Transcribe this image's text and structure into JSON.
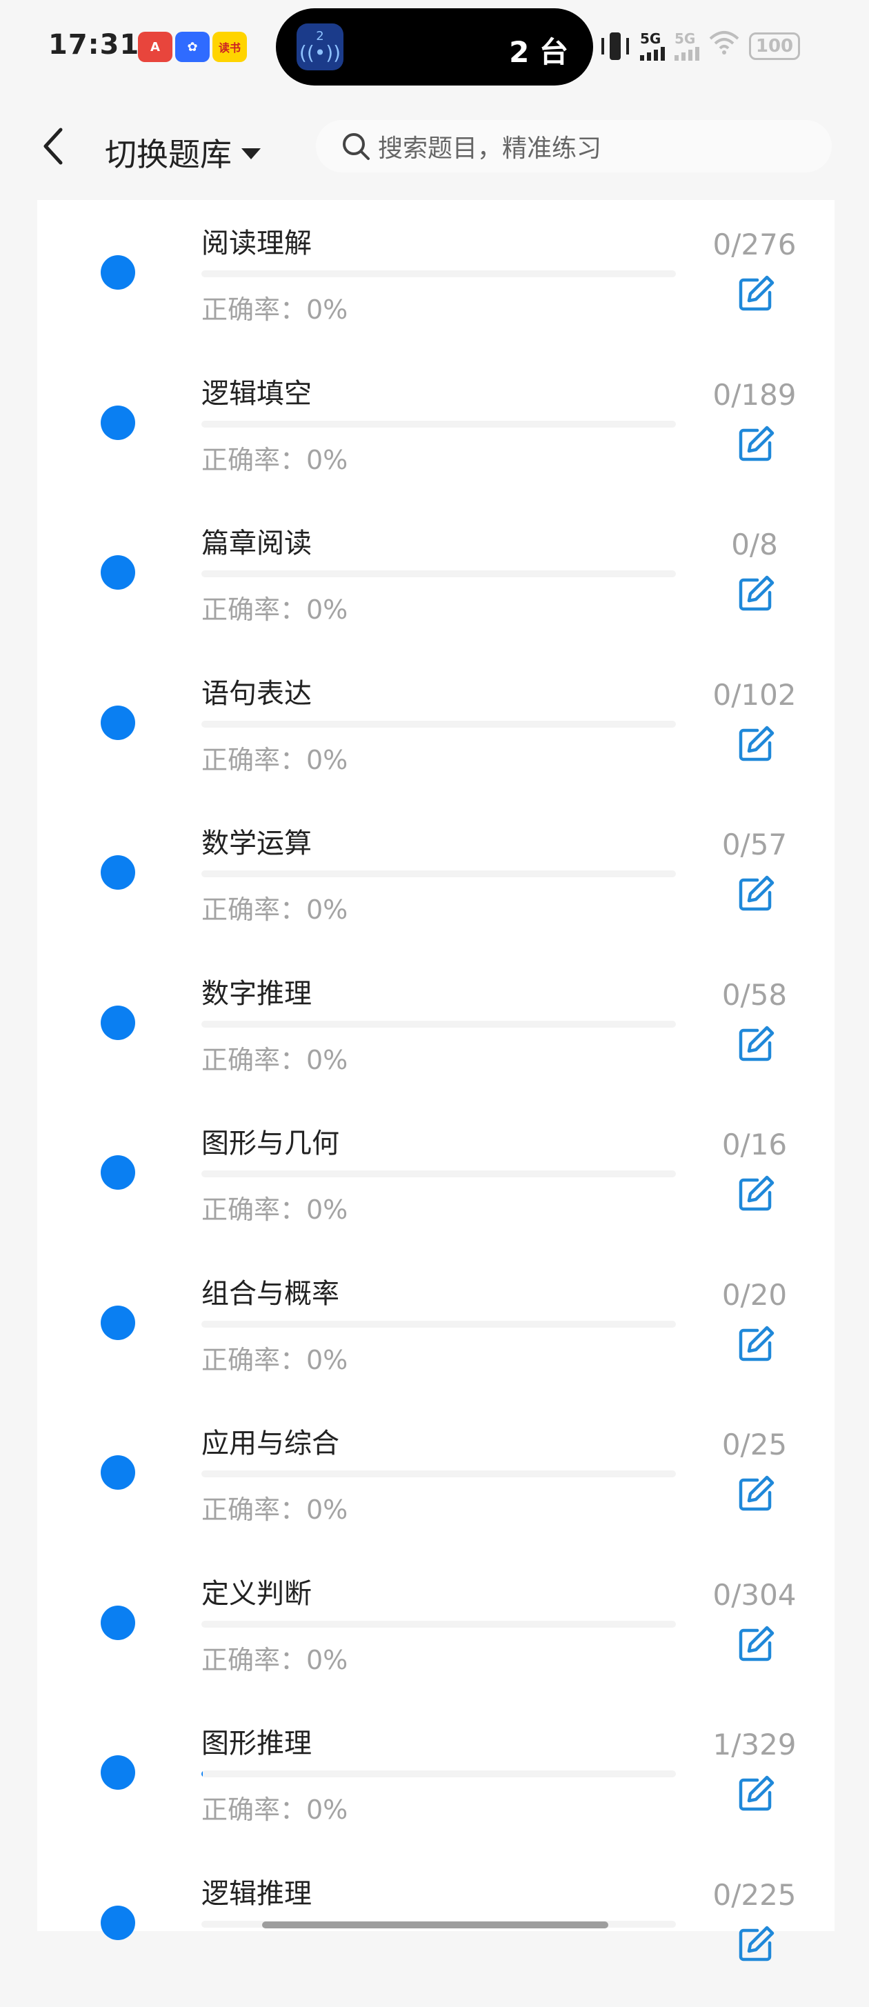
{
  "status_bar": {
    "time": "17:31",
    "app_badges": [
      "A",
      "✿",
      "读书"
    ],
    "island": {
      "app_number": "2",
      "text": "2 台"
    },
    "net_label": "5G",
    "net_label_2": "5G",
    "battery": "100"
  },
  "header": {
    "switch_label": "切换题库",
    "search_placeholder": "搜索题目，精准练习"
  },
  "accent_color": "#0a7ff2",
  "items": [
    {
      "title": "阅读理解",
      "accuracy": "正确率：0%",
      "count": "0/276",
      "progress": 0
    },
    {
      "title": "逻辑填空",
      "accuracy": "正确率：0%",
      "count": "0/189",
      "progress": 0
    },
    {
      "title": "篇章阅读",
      "accuracy": "正确率：0%",
      "count": "0/8",
      "progress": 0
    },
    {
      "title": "语句表达",
      "accuracy": "正确率：0%",
      "count": "0/102",
      "progress": 0
    },
    {
      "title": "数学运算",
      "accuracy": "正确率：0%",
      "count": "0/57",
      "progress": 0
    },
    {
      "title": "数字推理",
      "accuracy": "正确率：0%",
      "count": "0/58",
      "progress": 0
    },
    {
      "title": "图形与几何",
      "accuracy": "正确率：0%",
      "count": "0/16",
      "progress": 0
    },
    {
      "title": "组合与概率",
      "accuracy": "正确率：0%",
      "count": "0/20",
      "progress": 0
    },
    {
      "title": "应用与综合",
      "accuracy": "正确率：0%",
      "count": "0/25",
      "progress": 0
    },
    {
      "title": "定义判断",
      "accuracy": "正确率：0%",
      "count": "0/304",
      "progress": 0
    },
    {
      "title": "图形推理",
      "accuracy": "正确率：0%",
      "count": "1/329",
      "progress": 0.003
    },
    {
      "title": "逻辑推理",
      "accuracy": "",
      "count": "0/225",
      "progress": 0
    }
  ]
}
